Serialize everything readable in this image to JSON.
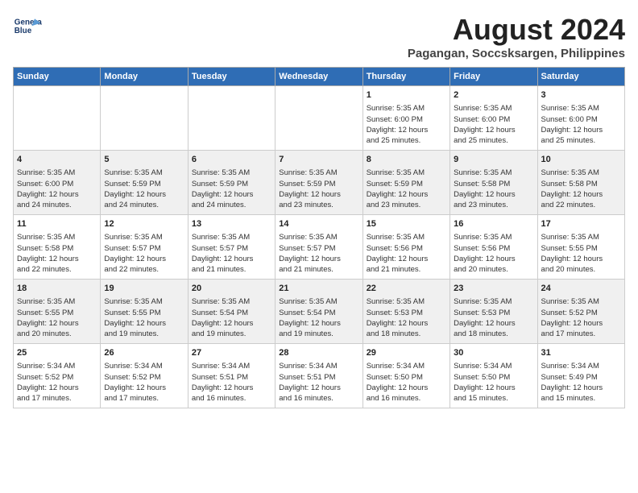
{
  "header": {
    "logo_line1": "General",
    "logo_line2": "Blue",
    "month_title": "August 2024",
    "location": "Pagangan, Soccsksargen, Philippines"
  },
  "days_of_week": [
    "Sunday",
    "Monday",
    "Tuesday",
    "Wednesday",
    "Thursday",
    "Friday",
    "Saturday"
  ],
  "weeks": [
    [
      {
        "day": "",
        "info": ""
      },
      {
        "day": "",
        "info": ""
      },
      {
        "day": "",
        "info": ""
      },
      {
        "day": "",
        "info": ""
      },
      {
        "day": "1",
        "info": "Sunrise: 5:35 AM\nSunset: 6:00 PM\nDaylight: 12 hours\nand 25 minutes."
      },
      {
        "day": "2",
        "info": "Sunrise: 5:35 AM\nSunset: 6:00 PM\nDaylight: 12 hours\nand 25 minutes."
      },
      {
        "day": "3",
        "info": "Sunrise: 5:35 AM\nSunset: 6:00 PM\nDaylight: 12 hours\nand 25 minutes."
      }
    ],
    [
      {
        "day": "4",
        "info": "Sunrise: 5:35 AM\nSunset: 6:00 PM\nDaylight: 12 hours\nand 24 minutes."
      },
      {
        "day": "5",
        "info": "Sunrise: 5:35 AM\nSunset: 5:59 PM\nDaylight: 12 hours\nand 24 minutes."
      },
      {
        "day": "6",
        "info": "Sunrise: 5:35 AM\nSunset: 5:59 PM\nDaylight: 12 hours\nand 24 minutes."
      },
      {
        "day": "7",
        "info": "Sunrise: 5:35 AM\nSunset: 5:59 PM\nDaylight: 12 hours\nand 23 minutes."
      },
      {
        "day": "8",
        "info": "Sunrise: 5:35 AM\nSunset: 5:59 PM\nDaylight: 12 hours\nand 23 minutes."
      },
      {
        "day": "9",
        "info": "Sunrise: 5:35 AM\nSunset: 5:58 PM\nDaylight: 12 hours\nand 23 minutes."
      },
      {
        "day": "10",
        "info": "Sunrise: 5:35 AM\nSunset: 5:58 PM\nDaylight: 12 hours\nand 22 minutes."
      }
    ],
    [
      {
        "day": "11",
        "info": "Sunrise: 5:35 AM\nSunset: 5:58 PM\nDaylight: 12 hours\nand 22 minutes."
      },
      {
        "day": "12",
        "info": "Sunrise: 5:35 AM\nSunset: 5:57 PM\nDaylight: 12 hours\nand 22 minutes."
      },
      {
        "day": "13",
        "info": "Sunrise: 5:35 AM\nSunset: 5:57 PM\nDaylight: 12 hours\nand 21 minutes."
      },
      {
        "day": "14",
        "info": "Sunrise: 5:35 AM\nSunset: 5:57 PM\nDaylight: 12 hours\nand 21 minutes."
      },
      {
        "day": "15",
        "info": "Sunrise: 5:35 AM\nSunset: 5:56 PM\nDaylight: 12 hours\nand 21 minutes."
      },
      {
        "day": "16",
        "info": "Sunrise: 5:35 AM\nSunset: 5:56 PM\nDaylight: 12 hours\nand 20 minutes."
      },
      {
        "day": "17",
        "info": "Sunrise: 5:35 AM\nSunset: 5:55 PM\nDaylight: 12 hours\nand 20 minutes."
      }
    ],
    [
      {
        "day": "18",
        "info": "Sunrise: 5:35 AM\nSunset: 5:55 PM\nDaylight: 12 hours\nand 20 minutes."
      },
      {
        "day": "19",
        "info": "Sunrise: 5:35 AM\nSunset: 5:55 PM\nDaylight: 12 hours\nand 19 minutes."
      },
      {
        "day": "20",
        "info": "Sunrise: 5:35 AM\nSunset: 5:54 PM\nDaylight: 12 hours\nand 19 minutes."
      },
      {
        "day": "21",
        "info": "Sunrise: 5:35 AM\nSunset: 5:54 PM\nDaylight: 12 hours\nand 19 minutes."
      },
      {
        "day": "22",
        "info": "Sunrise: 5:35 AM\nSunset: 5:53 PM\nDaylight: 12 hours\nand 18 minutes."
      },
      {
        "day": "23",
        "info": "Sunrise: 5:35 AM\nSunset: 5:53 PM\nDaylight: 12 hours\nand 18 minutes."
      },
      {
        "day": "24",
        "info": "Sunrise: 5:35 AM\nSunset: 5:52 PM\nDaylight: 12 hours\nand 17 minutes."
      }
    ],
    [
      {
        "day": "25",
        "info": "Sunrise: 5:34 AM\nSunset: 5:52 PM\nDaylight: 12 hours\nand 17 minutes."
      },
      {
        "day": "26",
        "info": "Sunrise: 5:34 AM\nSunset: 5:52 PM\nDaylight: 12 hours\nand 17 minutes."
      },
      {
        "day": "27",
        "info": "Sunrise: 5:34 AM\nSunset: 5:51 PM\nDaylight: 12 hours\nand 16 minutes."
      },
      {
        "day": "28",
        "info": "Sunrise: 5:34 AM\nSunset: 5:51 PM\nDaylight: 12 hours\nand 16 minutes."
      },
      {
        "day": "29",
        "info": "Sunrise: 5:34 AM\nSunset: 5:50 PM\nDaylight: 12 hours\nand 16 minutes."
      },
      {
        "day": "30",
        "info": "Sunrise: 5:34 AM\nSunset: 5:50 PM\nDaylight: 12 hours\nand 15 minutes."
      },
      {
        "day": "31",
        "info": "Sunrise: 5:34 AM\nSunset: 5:49 PM\nDaylight: 12 hours\nand 15 minutes."
      }
    ]
  ]
}
